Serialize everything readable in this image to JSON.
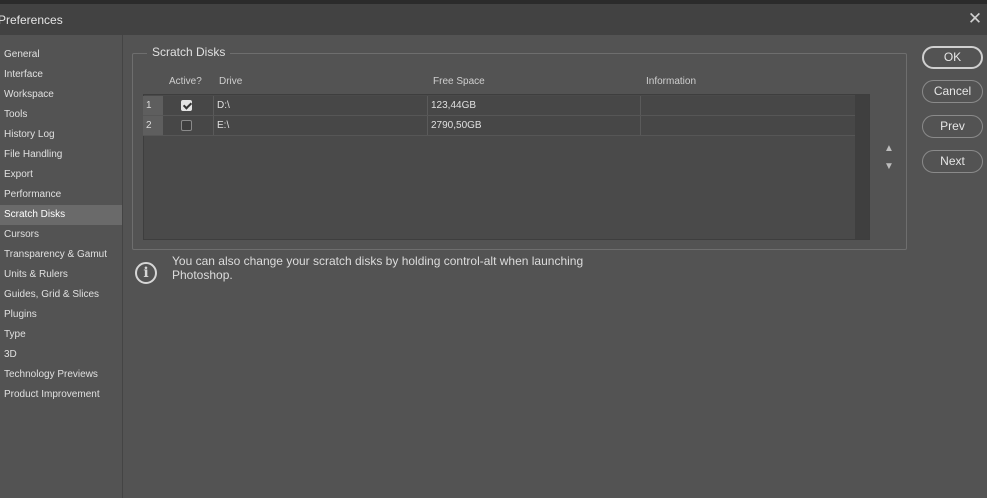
{
  "window": {
    "title": "Preferences"
  },
  "sidebar": {
    "items": [
      {
        "label": "General"
      },
      {
        "label": "Interface"
      },
      {
        "label": "Workspace"
      },
      {
        "label": "Tools"
      },
      {
        "label": "History Log"
      },
      {
        "label": "File Handling"
      },
      {
        "label": "Export"
      },
      {
        "label": "Performance"
      },
      {
        "label": "Scratch Disks"
      },
      {
        "label": "Cursors"
      },
      {
        "label": "Transparency & Gamut"
      },
      {
        "label": "Units & Rulers"
      },
      {
        "label": "Guides, Grid & Slices"
      },
      {
        "label": "Plugins"
      },
      {
        "label": "Type"
      },
      {
        "label": "3D"
      },
      {
        "label": "Technology Previews"
      },
      {
        "label": "Product Improvement"
      }
    ],
    "active": "Scratch Disks"
  },
  "scratch": {
    "group_label": "Scratch Disks",
    "columns": {
      "active": "Active?",
      "drive": "Drive",
      "free": "Free Space",
      "info": "Information"
    },
    "rows": [
      {
        "num": "1",
        "active": true,
        "drive": "D:\\",
        "free": "123,44GB",
        "info": ""
      },
      {
        "num": "2",
        "active": false,
        "drive": "E:\\",
        "free": "2790,50GB",
        "info": ""
      }
    ]
  },
  "info": {
    "text": "You can also change your scratch disks by holding control-alt when launching Photoshop."
  },
  "buttons": {
    "ok": "OK",
    "cancel": "Cancel",
    "prev": "Prev",
    "next": "Next"
  }
}
